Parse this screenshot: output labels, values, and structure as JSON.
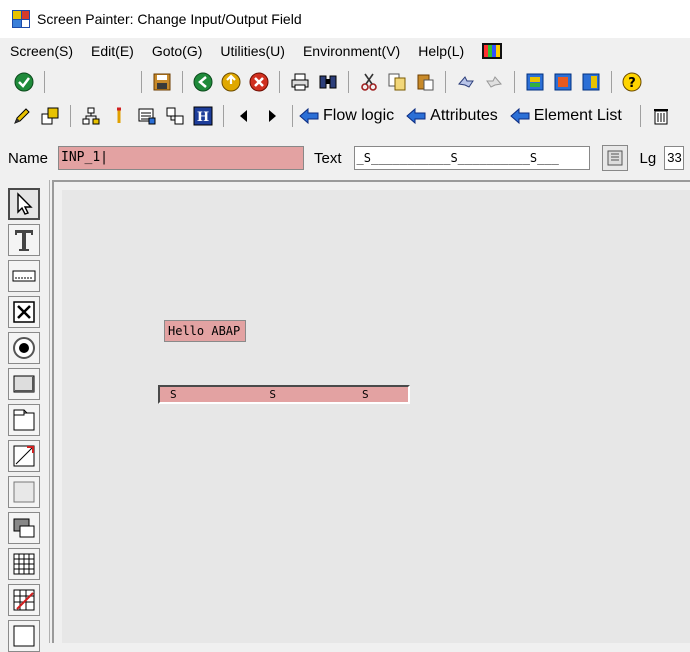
{
  "window": {
    "title": "Screen Painter:  Change Input/Output Field"
  },
  "menu": {
    "items": [
      "Screen(S)",
      "Edit(E)",
      "Goto(G)",
      "Utilities(U)",
      "Environment(V)",
      "Help(L)"
    ]
  },
  "toolbar2": {
    "flow_logic": "Flow logic",
    "attributes": "Attributes",
    "element_list": "Element List"
  },
  "fields": {
    "name_label": "Name",
    "name_value": "INP_1|",
    "text_label": "Text",
    "text_value": "_S___________S__________S___",
    "lg_label": "Lg",
    "lg_value": "33"
  },
  "canvas": {
    "text_element": "Hello ABAP",
    "io_element": "S              S             S"
  },
  "colors": {
    "field_pink": "#e3a2a2",
    "canvas_bg": "#e7e7e7",
    "toolbar_bg": "#f0f0f0"
  },
  "palette": {
    "tools": [
      "pointer-icon",
      "text-field-icon",
      "input-output-field-icon",
      "checkbox-icon",
      "radio-button-icon",
      "pushbutton-icon",
      "box-icon",
      "subscreen-icon",
      "table-control-icon",
      "tabstrip-icon",
      "custom-control-icon",
      "table-wizard-icon",
      "status-icon"
    ]
  }
}
